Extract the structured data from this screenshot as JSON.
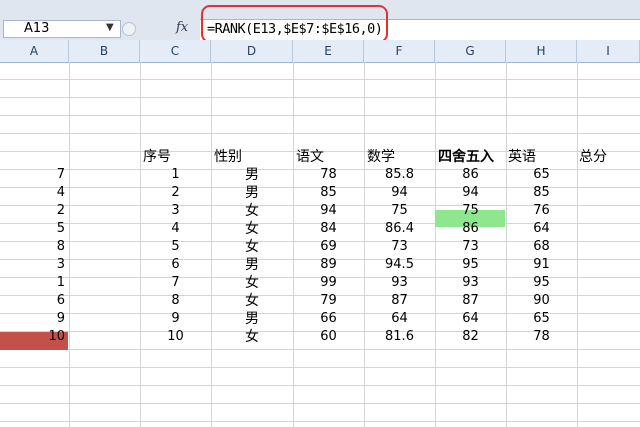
{
  "formula_bar": {
    "name_box": "A13",
    "fx_label": "fx",
    "formula": "=RANK(E13,$E$7:$E$16,0)"
  },
  "columns": [
    "A",
    "B",
    "C",
    "D",
    "E",
    "F",
    "G",
    "H",
    "I"
  ],
  "headers": {
    "index": "序号",
    "gender": "性别",
    "chinese": "语文",
    "math": "数学",
    "round": "四舍五入",
    "english": "英语",
    "total": "总分"
  },
  "rows": [
    {
      "rank": "7",
      "index": "1",
      "gender": "男",
      "chinese": "78",
      "math": "85.8",
      "round": "86",
      "english": "65"
    },
    {
      "rank": "4",
      "index": "2",
      "gender": "男",
      "chinese": "85",
      "math": "94",
      "round": "94",
      "english": "85"
    },
    {
      "rank": "2",
      "index": "3",
      "gender": "女",
      "chinese": "94",
      "math": "75",
      "round": "75",
      "english": "76"
    },
    {
      "rank": "5",
      "index": "4",
      "gender": "女",
      "chinese": "84",
      "math": "86.4",
      "round": "86",
      "english": "64"
    },
    {
      "rank": "8",
      "index": "5",
      "gender": "女",
      "chinese": "69",
      "math": "73",
      "round": "73",
      "english": "68"
    },
    {
      "rank": "3",
      "index": "6",
      "gender": "男",
      "chinese": "89",
      "math": "94.5",
      "round": "95",
      "english": "91"
    },
    {
      "rank": "1",
      "index": "7",
      "gender": "女",
      "chinese": "99",
      "math": "93",
      "round": "93",
      "english": "95"
    },
    {
      "rank": "6",
      "index": "8",
      "gender": "女",
      "chinese": "79",
      "math": "87",
      "round": "87",
      "english": "90"
    },
    {
      "rank": "9",
      "index": "9",
      "gender": "男",
      "chinese": "66",
      "math": "64",
      "round": "64",
      "english": "65"
    },
    {
      "rank": "10",
      "index": "10",
      "gender": "女",
      "chinese": "60",
      "math": "81.6",
      "round": "82",
      "english": "78"
    }
  ],
  "colors": {
    "annotation_outline": "#e63030",
    "selected_cell": "#c4504a",
    "header_highlight": "#8ee68e"
  }
}
